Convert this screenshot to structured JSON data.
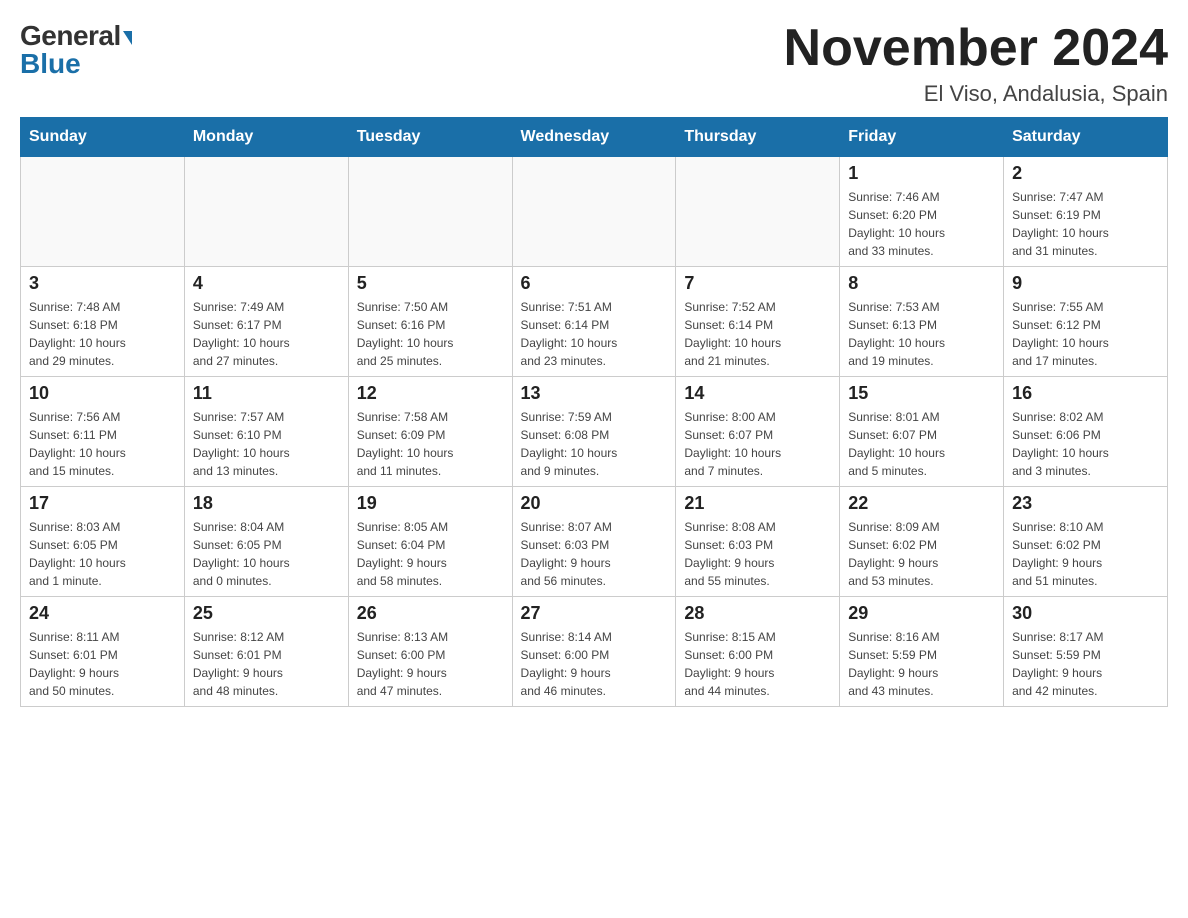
{
  "header": {
    "logo_general": "General",
    "logo_blue": "Blue",
    "title": "November 2024",
    "subtitle": "El Viso, Andalusia, Spain"
  },
  "weekdays": [
    "Sunday",
    "Monday",
    "Tuesday",
    "Wednesday",
    "Thursday",
    "Friday",
    "Saturday"
  ],
  "weeks": [
    [
      {
        "day": "",
        "info": ""
      },
      {
        "day": "",
        "info": ""
      },
      {
        "day": "",
        "info": ""
      },
      {
        "day": "",
        "info": ""
      },
      {
        "day": "",
        "info": ""
      },
      {
        "day": "1",
        "info": "Sunrise: 7:46 AM\nSunset: 6:20 PM\nDaylight: 10 hours\nand 33 minutes."
      },
      {
        "day": "2",
        "info": "Sunrise: 7:47 AM\nSunset: 6:19 PM\nDaylight: 10 hours\nand 31 minutes."
      }
    ],
    [
      {
        "day": "3",
        "info": "Sunrise: 7:48 AM\nSunset: 6:18 PM\nDaylight: 10 hours\nand 29 minutes."
      },
      {
        "day": "4",
        "info": "Sunrise: 7:49 AM\nSunset: 6:17 PM\nDaylight: 10 hours\nand 27 minutes."
      },
      {
        "day": "5",
        "info": "Sunrise: 7:50 AM\nSunset: 6:16 PM\nDaylight: 10 hours\nand 25 minutes."
      },
      {
        "day": "6",
        "info": "Sunrise: 7:51 AM\nSunset: 6:14 PM\nDaylight: 10 hours\nand 23 minutes."
      },
      {
        "day": "7",
        "info": "Sunrise: 7:52 AM\nSunset: 6:14 PM\nDaylight: 10 hours\nand 21 minutes."
      },
      {
        "day": "8",
        "info": "Sunrise: 7:53 AM\nSunset: 6:13 PM\nDaylight: 10 hours\nand 19 minutes."
      },
      {
        "day": "9",
        "info": "Sunrise: 7:55 AM\nSunset: 6:12 PM\nDaylight: 10 hours\nand 17 minutes."
      }
    ],
    [
      {
        "day": "10",
        "info": "Sunrise: 7:56 AM\nSunset: 6:11 PM\nDaylight: 10 hours\nand 15 minutes."
      },
      {
        "day": "11",
        "info": "Sunrise: 7:57 AM\nSunset: 6:10 PM\nDaylight: 10 hours\nand 13 minutes."
      },
      {
        "day": "12",
        "info": "Sunrise: 7:58 AM\nSunset: 6:09 PM\nDaylight: 10 hours\nand 11 minutes."
      },
      {
        "day": "13",
        "info": "Sunrise: 7:59 AM\nSunset: 6:08 PM\nDaylight: 10 hours\nand 9 minutes."
      },
      {
        "day": "14",
        "info": "Sunrise: 8:00 AM\nSunset: 6:07 PM\nDaylight: 10 hours\nand 7 minutes."
      },
      {
        "day": "15",
        "info": "Sunrise: 8:01 AM\nSunset: 6:07 PM\nDaylight: 10 hours\nand 5 minutes."
      },
      {
        "day": "16",
        "info": "Sunrise: 8:02 AM\nSunset: 6:06 PM\nDaylight: 10 hours\nand 3 minutes."
      }
    ],
    [
      {
        "day": "17",
        "info": "Sunrise: 8:03 AM\nSunset: 6:05 PM\nDaylight: 10 hours\nand 1 minute."
      },
      {
        "day": "18",
        "info": "Sunrise: 8:04 AM\nSunset: 6:05 PM\nDaylight: 10 hours\nand 0 minutes."
      },
      {
        "day": "19",
        "info": "Sunrise: 8:05 AM\nSunset: 6:04 PM\nDaylight: 9 hours\nand 58 minutes."
      },
      {
        "day": "20",
        "info": "Sunrise: 8:07 AM\nSunset: 6:03 PM\nDaylight: 9 hours\nand 56 minutes."
      },
      {
        "day": "21",
        "info": "Sunrise: 8:08 AM\nSunset: 6:03 PM\nDaylight: 9 hours\nand 55 minutes."
      },
      {
        "day": "22",
        "info": "Sunrise: 8:09 AM\nSunset: 6:02 PM\nDaylight: 9 hours\nand 53 minutes."
      },
      {
        "day": "23",
        "info": "Sunrise: 8:10 AM\nSunset: 6:02 PM\nDaylight: 9 hours\nand 51 minutes."
      }
    ],
    [
      {
        "day": "24",
        "info": "Sunrise: 8:11 AM\nSunset: 6:01 PM\nDaylight: 9 hours\nand 50 minutes."
      },
      {
        "day": "25",
        "info": "Sunrise: 8:12 AM\nSunset: 6:01 PM\nDaylight: 9 hours\nand 48 minutes."
      },
      {
        "day": "26",
        "info": "Sunrise: 8:13 AM\nSunset: 6:00 PM\nDaylight: 9 hours\nand 47 minutes."
      },
      {
        "day": "27",
        "info": "Sunrise: 8:14 AM\nSunset: 6:00 PM\nDaylight: 9 hours\nand 46 minutes."
      },
      {
        "day": "28",
        "info": "Sunrise: 8:15 AM\nSunset: 6:00 PM\nDaylight: 9 hours\nand 44 minutes."
      },
      {
        "day": "29",
        "info": "Sunrise: 8:16 AM\nSunset: 5:59 PM\nDaylight: 9 hours\nand 43 minutes."
      },
      {
        "day": "30",
        "info": "Sunrise: 8:17 AM\nSunset: 5:59 PM\nDaylight: 9 hours\nand 42 minutes."
      }
    ]
  ]
}
